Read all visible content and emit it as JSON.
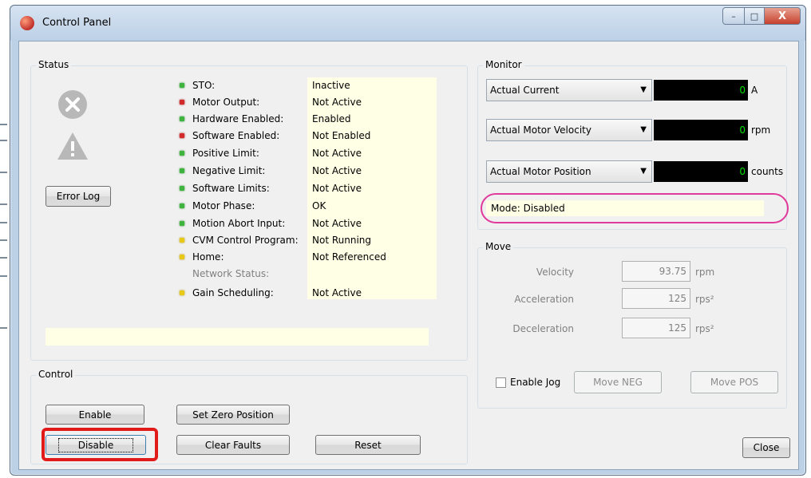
{
  "window": {
    "title": "Control Panel",
    "controls": {
      "minimize": "–",
      "maximize": "□",
      "close": "X"
    }
  },
  "status": {
    "group_title": "Status",
    "error_log_label": "Error Log",
    "rows": [
      {
        "label": "STO:",
        "value": "Inactive",
        "led": "green"
      },
      {
        "label": "Motor Output:",
        "value": "Not Active",
        "led": "red"
      },
      {
        "label": "Hardware Enabled:",
        "value": "Enabled",
        "led": "green"
      },
      {
        "label": "Software Enabled:",
        "value": "Not Enabled",
        "led": "red"
      },
      {
        "label": "Positive Limit:",
        "value": "Not Active",
        "led": "green"
      },
      {
        "label": "Negative Limit:",
        "value": "Not Active",
        "led": "green"
      },
      {
        "label": "Software Limits:",
        "value": "Not Active",
        "led": "green"
      },
      {
        "label": "Motor Phase:",
        "value": "OK",
        "led": "green"
      },
      {
        "label": "Motion Abort Input:",
        "value": "Not Active",
        "led": "green"
      },
      {
        "label": "CVM Control Program:",
        "value": "Not Running",
        "led": "yellow"
      },
      {
        "label": "Home:",
        "value": "Not Referenced",
        "led": "yellow"
      },
      {
        "label": "Network Status:",
        "value": "",
        "led": "none"
      },
      {
        "label": "Gain Scheduling:",
        "value": "Not Active",
        "led": "yellow"
      }
    ],
    "message": ""
  },
  "monitor": {
    "group_title": "Monitor",
    "channels": [
      {
        "selected": "Actual Current",
        "value": "0",
        "unit": "A"
      },
      {
        "selected": "Actual Motor Velocity",
        "value": "0",
        "unit": "rpm"
      },
      {
        "selected": "Actual Motor Position",
        "value": "0",
        "unit": "counts"
      }
    ],
    "mode_label": "Mode:",
    "mode_value": "Disabled"
  },
  "move": {
    "group_title": "Move",
    "fields": [
      {
        "label": "Velocity",
        "value": "93.75",
        "unit": "rpm"
      },
      {
        "label": "Acceleration",
        "value": "125",
        "unit": "rps²"
      },
      {
        "label": "Deceleration",
        "value": "125",
        "unit": "rps²"
      }
    ],
    "enable_jog_label": "Enable Jog",
    "move_neg_label": "Move NEG",
    "move_pos_label": "Move POS"
  },
  "control": {
    "group_title": "Control",
    "enable_label": "Enable",
    "disable_label": "Disable",
    "set_zero_label": "Set Zero Position",
    "clear_faults_label": "Clear Faults",
    "reset_label": "Reset"
  },
  "close_label": "Close",
  "colors": {
    "led_green": "#3eb43e",
    "led_red": "#d22a2a",
    "led_yellow": "#e8c918",
    "readout_text": "#00e000",
    "highlight_red": "#e11a1a",
    "annotation_pink": "#e03a9a"
  }
}
